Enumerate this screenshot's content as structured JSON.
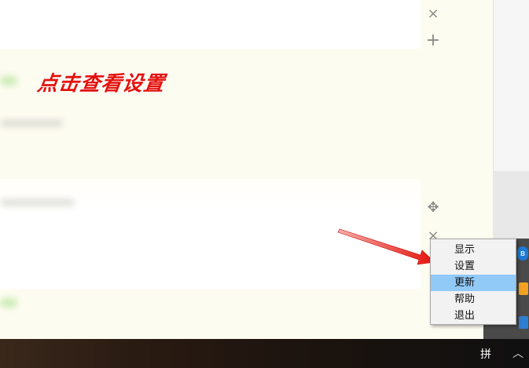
{
  "annotation": {
    "text": "点击查看设置"
  },
  "side_buttons": {
    "close_top": "×",
    "add": "+",
    "move": "✥",
    "close_bottom": "×"
  },
  "context_menu": {
    "items": [
      "显示",
      "设置",
      "更新",
      "帮助",
      "退出"
    ],
    "highlighted_index": 2
  },
  "tray": {
    "bluetooth_glyph": "ʙ"
  },
  "taskbar": {
    "ime_label": "拼",
    "chevron": "︿"
  },
  "colors": {
    "annotation": "#e3120b",
    "arrow": "#e3120b",
    "menu_highlight": "#91c9f7",
    "taskbar": "#2a1b12"
  }
}
